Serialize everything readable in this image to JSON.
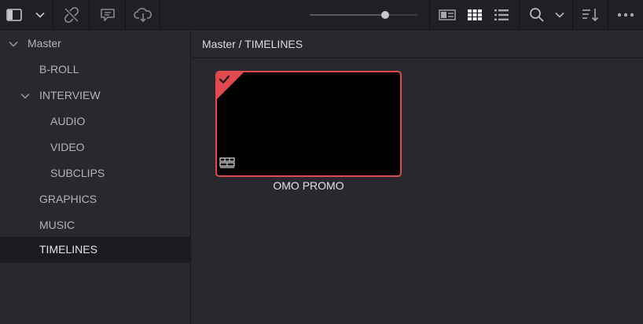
{
  "toolbar": {
    "zoom_level": 0.7
  },
  "colors": {
    "selection_accent": "#e04a4e",
    "sidebar_selected": "#1b1b1f"
  },
  "sidebar": {
    "master": "Master",
    "b_roll": "B-ROLL",
    "interview": "INTERVIEW",
    "audio": "AUDIO",
    "video": "VIDEO",
    "subclips": "SUBCLIPS",
    "graphics": "GRAPHICS",
    "music": "MUSIC",
    "timelines": "TIMELINES",
    "selected": "TIMELINES"
  },
  "main": {
    "breadcrumb": "Master / TIMELINES",
    "clips": [
      {
        "name": "OMO PROMO",
        "selected": true,
        "type_icon": "timeline-icon"
      }
    ]
  }
}
